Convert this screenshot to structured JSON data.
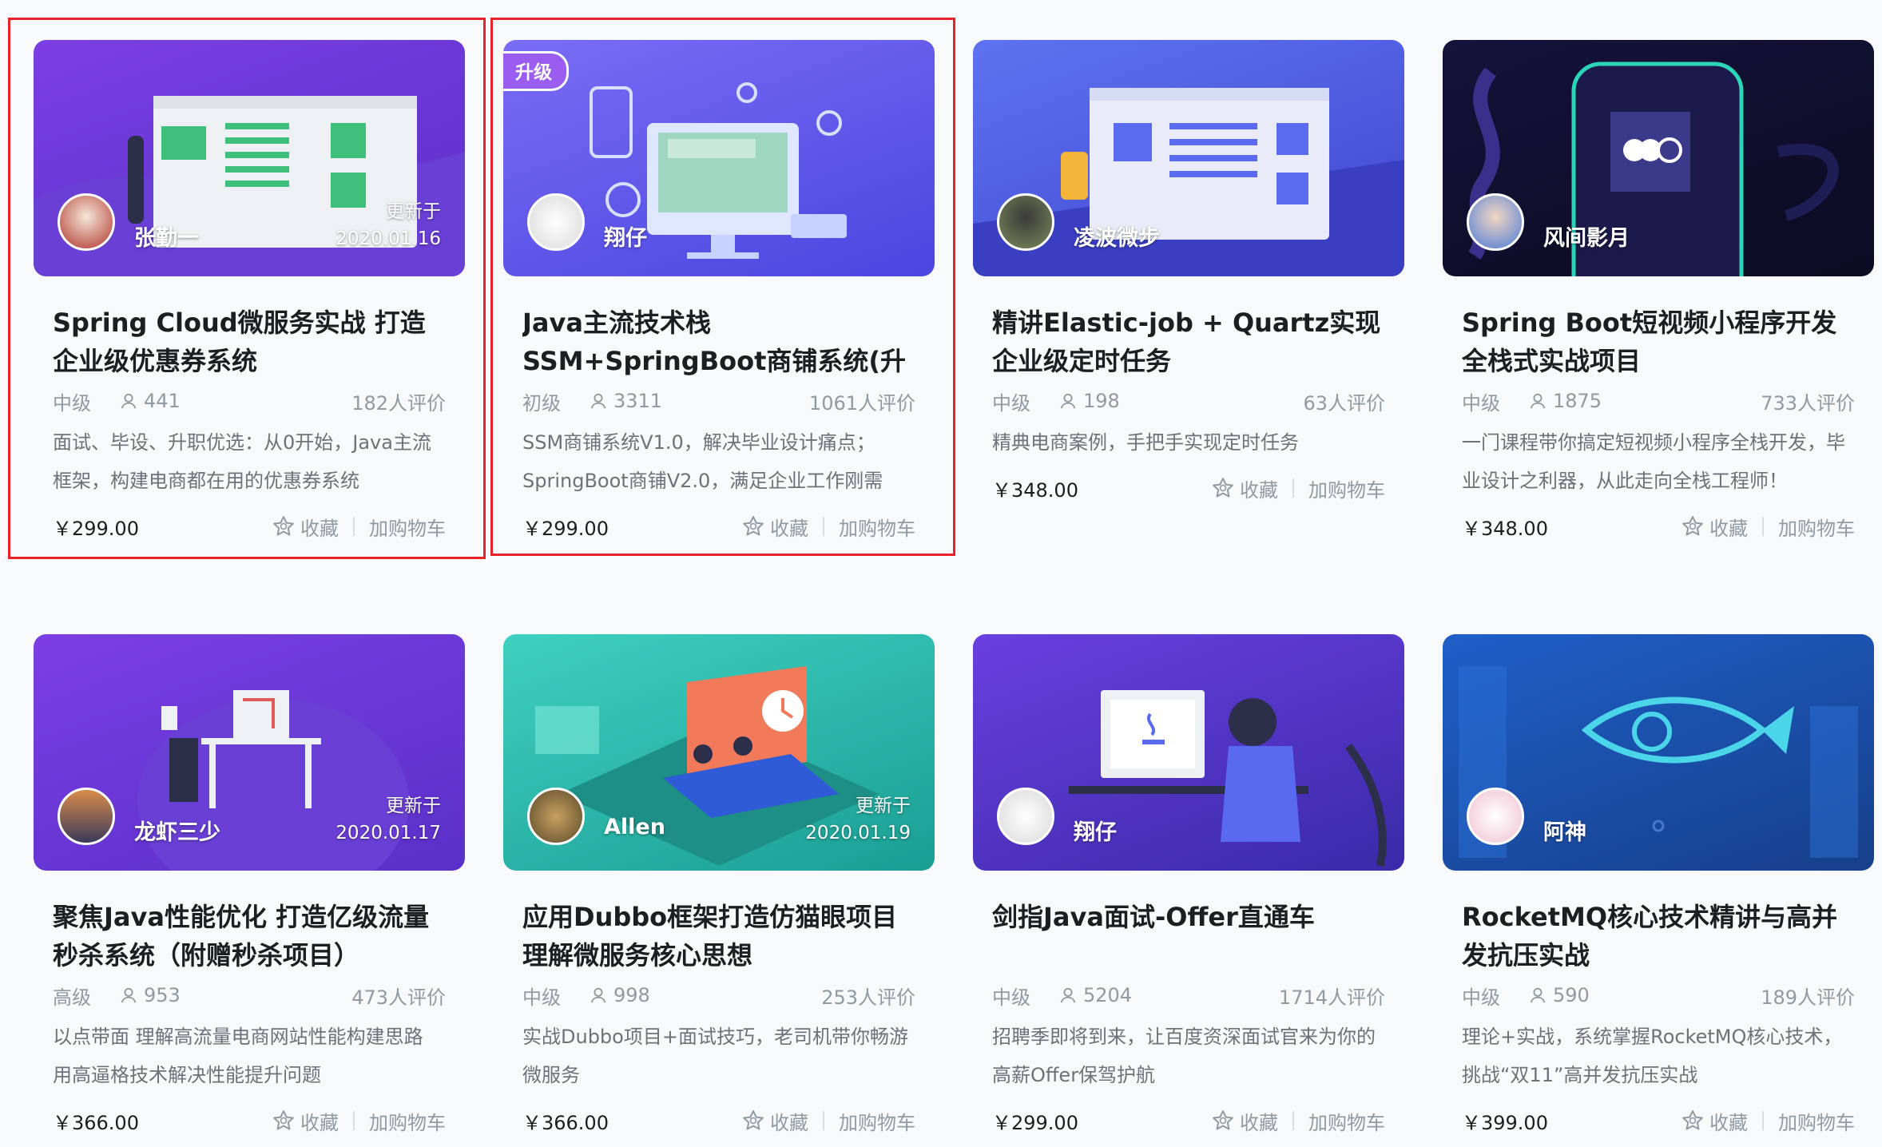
{
  "labels": {
    "favorite": "收藏",
    "add_to_cart": "加购物车",
    "updated_prefix": "更新于",
    "upgrade_badge": "升级"
  },
  "colors": {
    "highlight_border": "#e8212a",
    "price": "#1c1f21",
    "meta_gray": "#9199a1"
  },
  "courses": [
    {
      "title": "Spring Cloud微服务实战 打造企业级优惠券系统",
      "author": "张勤一",
      "updated": "2020.01.16",
      "level": "中级",
      "students": "441",
      "reviews": "182人评价",
      "description": "面试、毕设、升职优选：从0开始，Java主流框架，构建电商都在用的优惠券系统",
      "price": "￥299.00",
      "highlighted": true
    },
    {
      "title": "Java主流技术栈SSM+SpringBoot商铺系统(升级更新)",
      "author": "翔仔",
      "badge": "升级",
      "level": "初级",
      "students": "3311",
      "reviews": "1061人评价",
      "description": "SSM商铺系统V1.0，解决毕业设计痛点；SpringBoot商铺V2.0，满足企业工作刚需",
      "price": "￥299.00",
      "highlighted": true
    },
    {
      "title": "精讲Elastic-job + Quartz实现企业级定时任务",
      "author": "凌波微步",
      "level": "中级",
      "students": "198",
      "reviews": "63人评价",
      "description": "精典电商案例，手把手实现定时任务",
      "price": "￥348.00"
    },
    {
      "title": "Spring Boot短视频小程序开发 全栈式实战项目",
      "author": "风间影月",
      "level": "中级",
      "students": "1875",
      "reviews": "733人评价",
      "description": "一门课程带你搞定短视频小程序全栈开发，毕业设计之利器，从此走向全栈工程师！",
      "price": "￥348.00"
    },
    {
      "title": "聚焦Java性能优化 打造亿级流量秒杀系统（附赠秒杀项目）",
      "author": "龙虾三少",
      "updated": "2020.01.17",
      "level": "高级",
      "students": "953",
      "reviews": "473人评价",
      "description": "以点带面 理解高流量电商网站性能构建思路 用高逼格技术解决性能提升问题",
      "price": "￥366.00"
    },
    {
      "title": "应用Dubbo框架打造仿猫眼项目 理解微服务核心思想",
      "author": "Allen",
      "updated": "2020.01.19",
      "level": "中级",
      "students": "998",
      "reviews": "253人评价",
      "description": "实战Dubbo项目+面试技巧，老司机带你畅游微服务",
      "price": "￥366.00"
    },
    {
      "title": "剑指Java面试-Offer直通车",
      "author": "翔仔",
      "level": "中级",
      "students": "5204",
      "reviews": "1714人评价",
      "description": "招聘季即将到来，让百度资深面试官来为你的高薪Offer保驾护航",
      "price": "￥299.00"
    },
    {
      "title": "RocketMQ核心技术精讲与高并发抗压实战",
      "author": "阿神",
      "level": "中级",
      "students": "590",
      "reviews": "189人评价",
      "description": "理论+实战，系统掌握RocketMQ核心技术，挑战“双11”高并发抗压实战",
      "price": "￥399.00"
    }
  ]
}
